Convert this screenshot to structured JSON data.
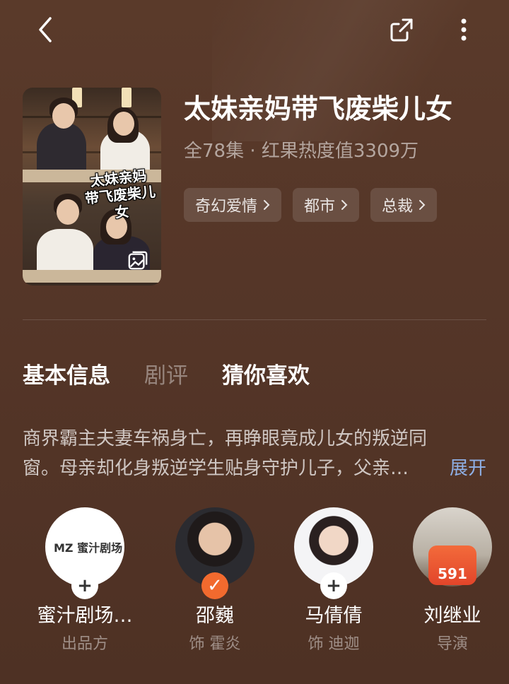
{
  "topbar": {
    "back_icon": "chevron-left-icon",
    "share_icon": "share-icon",
    "more_icon": "more-vertical-icon"
  },
  "cover": {
    "title_line1": "太妹亲妈",
    "title_line2": "带飞废柴儿女",
    "album_icon": "gallery-icon"
  },
  "drama": {
    "title": "太妹亲妈带飞废柴儿女",
    "meta": "全78集 · 红果热度值3309万",
    "tags": [
      {
        "label": "奇幻爱情"
      },
      {
        "label": "都市"
      },
      {
        "label": "总裁"
      }
    ]
  },
  "tabs": [
    {
      "label": "基本信息",
      "active": true
    },
    {
      "label": "剧评",
      "active": false
    },
    {
      "label": "猜你喜欢",
      "active": false
    }
  ],
  "synopsis": {
    "line1": "商界霸主夫妻车祸身亡，再睁眼竟成儿女的叛逆同",
    "line2": "窗。母亲却化身叛逆学生贴身守护儿子，父亲…",
    "expand_label": "展开"
  },
  "cast": [
    {
      "name": "蜜汁剧场…",
      "role": "出品方",
      "logo_text": "MZ 蜜汁剧场",
      "badge": "+",
      "badge_type": "add"
    },
    {
      "name": "邵巍",
      "role": "饰 霍炎",
      "badge": "✓",
      "badge_type": "followed"
    },
    {
      "name": "马倩倩",
      "role": "饰 迪迦",
      "badge": "+",
      "badge_type": "add"
    },
    {
      "name": "刘继业",
      "role": "导演",
      "redpacket": "591"
    }
  ],
  "colors": {
    "background": "#553628",
    "accent_link": "#8fb0e6",
    "followed_badge": "#f26a2e"
  }
}
